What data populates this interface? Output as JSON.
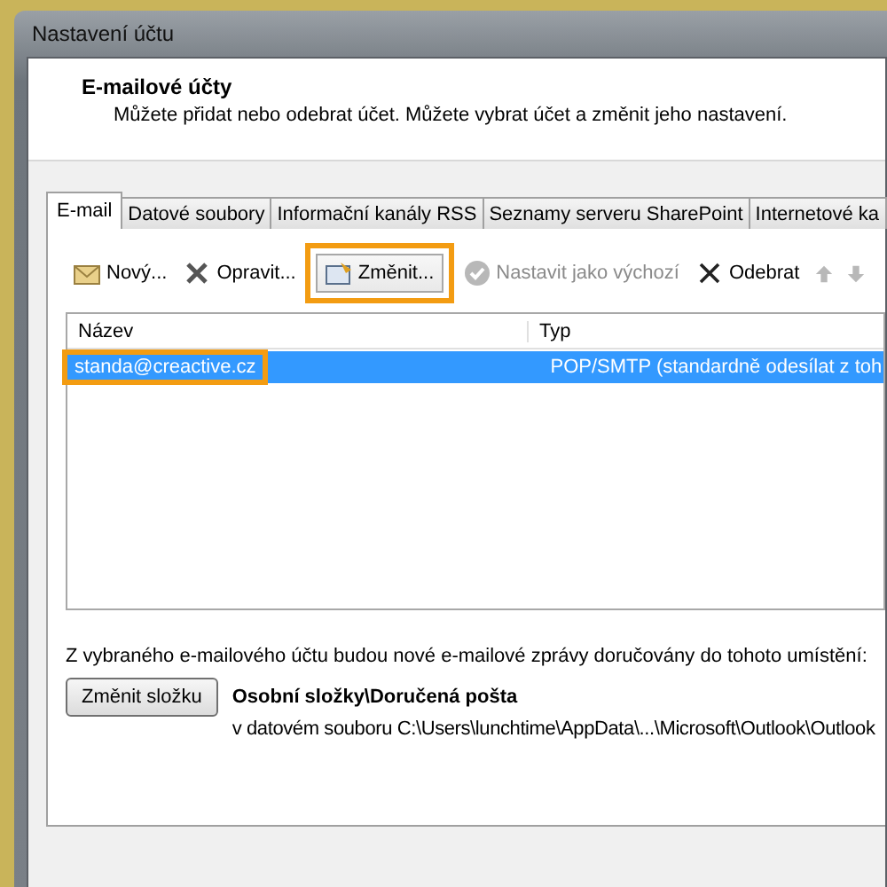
{
  "window": {
    "title": "Nastavení účtu"
  },
  "header": {
    "title": "E-mailové účty",
    "description": "Můžete přidat nebo odebrat účet. Můžete vybrat účet a změnit jeho nastavení."
  },
  "tabs": [
    {
      "label": "E-mail",
      "selected": true
    },
    {
      "label": "Datové soubory",
      "selected": false
    },
    {
      "label": "Informační kanály RSS",
      "selected": false
    },
    {
      "label": "Seznamy serveru SharePoint",
      "selected": false
    },
    {
      "label": "Internetové ka",
      "selected": false
    }
  ],
  "toolbar": [
    {
      "label": "Nový...",
      "disabled": false,
      "highlighted": false
    },
    {
      "label": "Opravit...",
      "disabled": false,
      "highlighted": false
    },
    {
      "label": "Změnit...",
      "disabled": false,
      "highlighted": true
    },
    {
      "label": "Nastavit jako výchozí",
      "disabled": true,
      "highlighted": false
    },
    {
      "label": "Odebrat",
      "disabled": false,
      "highlighted": false
    }
  ],
  "move_buttons": [
    {
      "disabled": true
    },
    {
      "disabled": true
    }
  ],
  "table": {
    "columns": [
      "Název",
      "Typ"
    ],
    "rows": [
      {
        "name": "standa@creactive.cz",
        "type": "POP/SMTP (standardně odesílat z toh",
        "selected": true,
        "highlighted": true
      }
    ]
  },
  "delivery": {
    "text": "Z vybraného e-mailového účtu budou nové e-mailové zprávy doručovány do tohoto umístění:",
    "button": "Změnit složku",
    "folder": "Osobní složky\\Doručená pošta",
    "path": "v datovém souboru C:\\Users\\lunchtime\\AppData\\...\\Microsoft\\Outlook\\Outlook"
  }
}
